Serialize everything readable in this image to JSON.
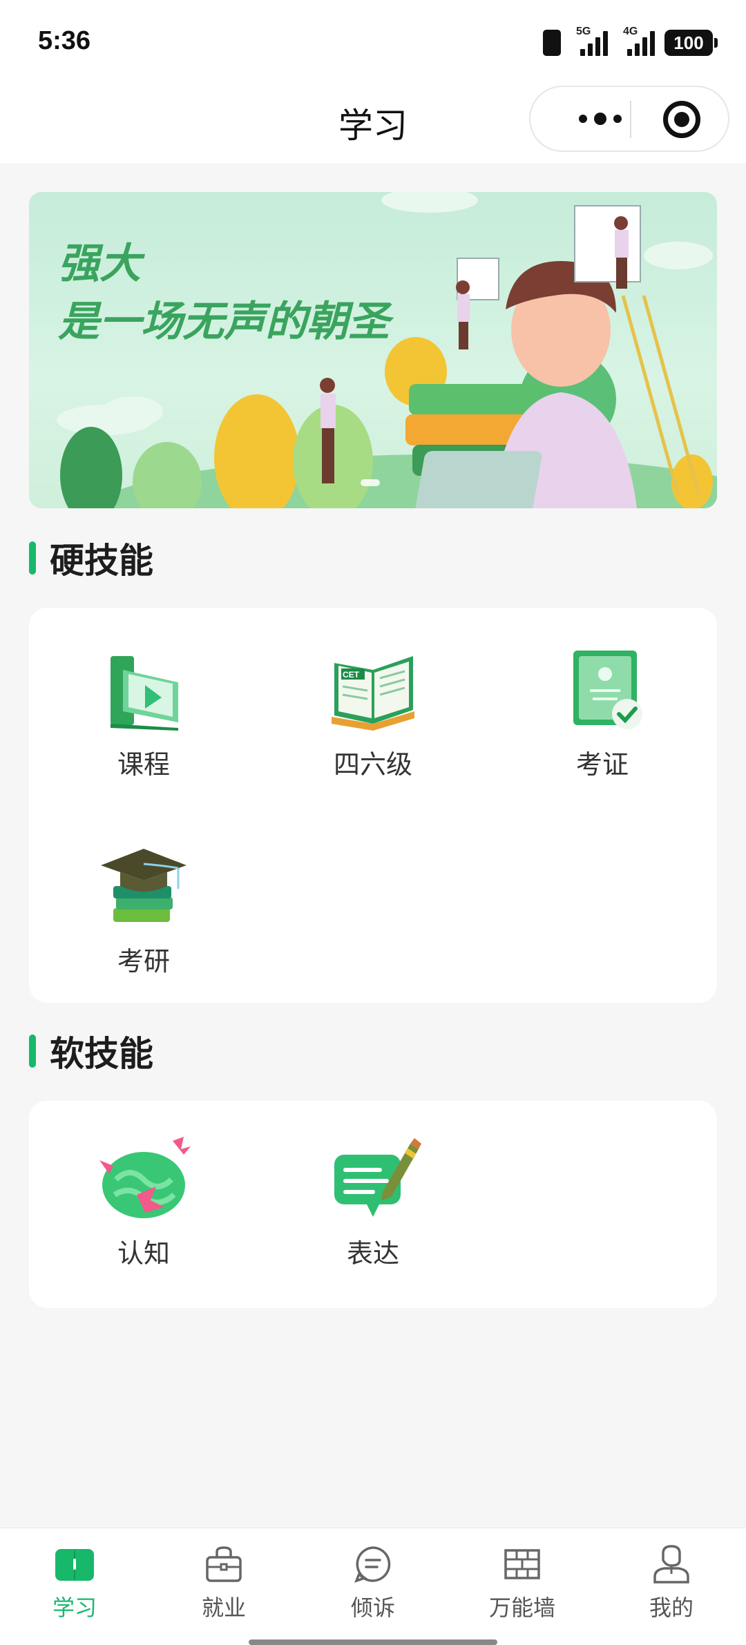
{
  "status_bar": {
    "time": "5:36",
    "network_5g": "5G",
    "network_4g": "4G",
    "battery": "100",
    "icons": [
      "vibrate-icon",
      "signal-5g-icon",
      "signal-4g-icon",
      "battery-icon"
    ]
  },
  "nav": {
    "title": "学习",
    "capsule_icons": [
      "more-dots-icon",
      "close-target-icon"
    ]
  },
  "banner": {
    "line1": "强大",
    "line2": "是一场无声的朝圣"
  },
  "hard_skills": {
    "title": "硬技能",
    "items": [
      {
        "label": "课程",
        "icon": "book-play-icon"
      },
      {
        "label": "四六级",
        "icon": "cet-book-icon"
      },
      {
        "label": "考证",
        "icon": "certificate-icon"
      },
      {
        "label": "考研",
        "icon": "graduation-cap-icon"
      }
    ]
  },
  "soft_skills": {
    "title": "软技能",
    "items": [
      {
        "label": "认知",
        "icon": "brain-icon"
      },
      {
        "label": "表达",
        "icon": "chat-pencil-icon"
      }
    ]
  },
  "tab_bar": {
    "active_color": "#18b86a",
    "items": [
      {
        "label": "学习",
        "icon": "book-icon",
        "active": true
      },
      {
        "label": "就业",
        "icon": "briefcase-icon",
        "active": false
      },
      {
        "label": "倾诉",
        "icon": "chat-bubble-icon",
        "active": false
      },
      {
        "label": "万能墙",
        "icon": "wall-icon",
        "active": false
      },
      {
        "label": "我的",
        "icon": "user-icon",
        "active": false
      }
    ]
  },
  "colors": {
    "accent": "#18b86a",
    "background": "#f6f6f6",
    "banner_text": "#3aa45e"
  }
}
